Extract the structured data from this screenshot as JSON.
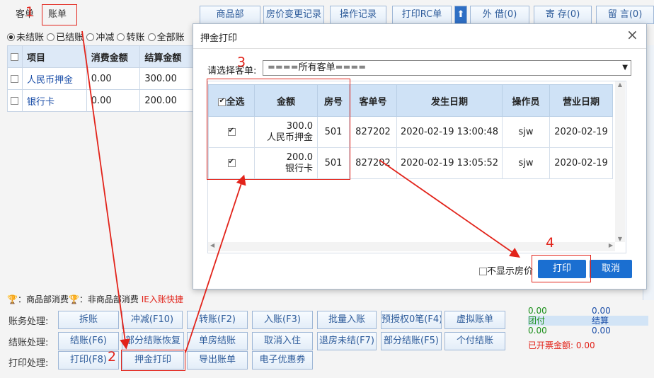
{
  "tabs": {
    "guest_order": "客单",
    "bill": "账单"
  },
  "top_buttons": [
    "商品部",
    "房价变更记录",
    "操作记录",
    "打印RC单",
    "外 借(0)",
    "寄 存(0)",
    "留 言(0)"
  ],
  "filters": [
    "未结账",
    "已结账",
    "冲减",
    "转账",
    "全部账"
  ],
  "grid": {
    "headers": [
      "项目",
      "消费金额",
      "结算金额"
    ],
    "rows": [
      {
        "item": "人民币押金",
        "consume": "0.00",
        "settle": "300.00"
      },
      {
        "item": "银行卡",
        "consume": "0.00",
        "settle": "200.00"
      }
    ]
  },
  "legend": {
    "goods": "：商品部消费",
    "non_goods": "：非商品部消费",
    "ie_note": "IE入账快捷"
  },
  "actions": {
    "row1_label": "账务处理:",
    "row1": [
      "拆账",
      "冲减(F10)",
      "转账(F2)",
      "入账(F3)",
      "批量入账",
      "预授权0笔(F4)",
      "虚拟账单"
    ],
    "row2_label": "结账处理:",
    "row2": [
      "结账(F6)",
      "部分结账恢复",
      "单房结账",
      "取消入住",
      "退房未结(F7)",
      "部分结账(F5)",
      "个付结账"
    ],
    "row3_label": "打印处理:",
    "row3": [
      "打印(F8)",
      "押金打印",
      "导出账单",
      "电子优惠券"
    ]
  },
  "summary": {
    "v1": "0.00",
    "v2": "0.00",
    "v3": "0.00",
    "v4": "0.00",
    "team_pay": "团付",
    "settle": "结算",
    "invoiced": "已开票金额:",
    "invoiced_val": "0.00"
  },
  "dialog": {
    "title": "押金打印",
    "select_label": "请选择客单:",
    "select_value": "====所有客单====",
    "headers": [
      "全选",
      "金额",
      "房号",
      "客单号",
      "发生日期",
      "操作员",
      "营业日期"
    ],
    "rows": [
      {
        "amount": "300.0",
        "type": "人民币押金",
        "room": "501",
        "order": "827202",
        "date": "2020-02-19 13:00:48",
        "operator": "sjw",
        "biz_date": "2020-02-19"
      },
      {
        "amount": "200.0",
        "type": "银行卡",
        "room": "501",
        "order": "827202",
        "date": "2020-02-19 13:05:52",
        "operator": "sjw",
        "biz_date": "2020-02-19"
      }
    ],
    "hide_price": "不显示房价",
    "print": "打印",
    "cancel": "取消"
  },
  "annotations": [
    "1",
    "2",
    "3",
    "4"
  ],
  "colors": {
    "accent": "#1b6fd1",
    "annotation": "#e2231a",
    "header": "#cfe2f6"
  }
}
